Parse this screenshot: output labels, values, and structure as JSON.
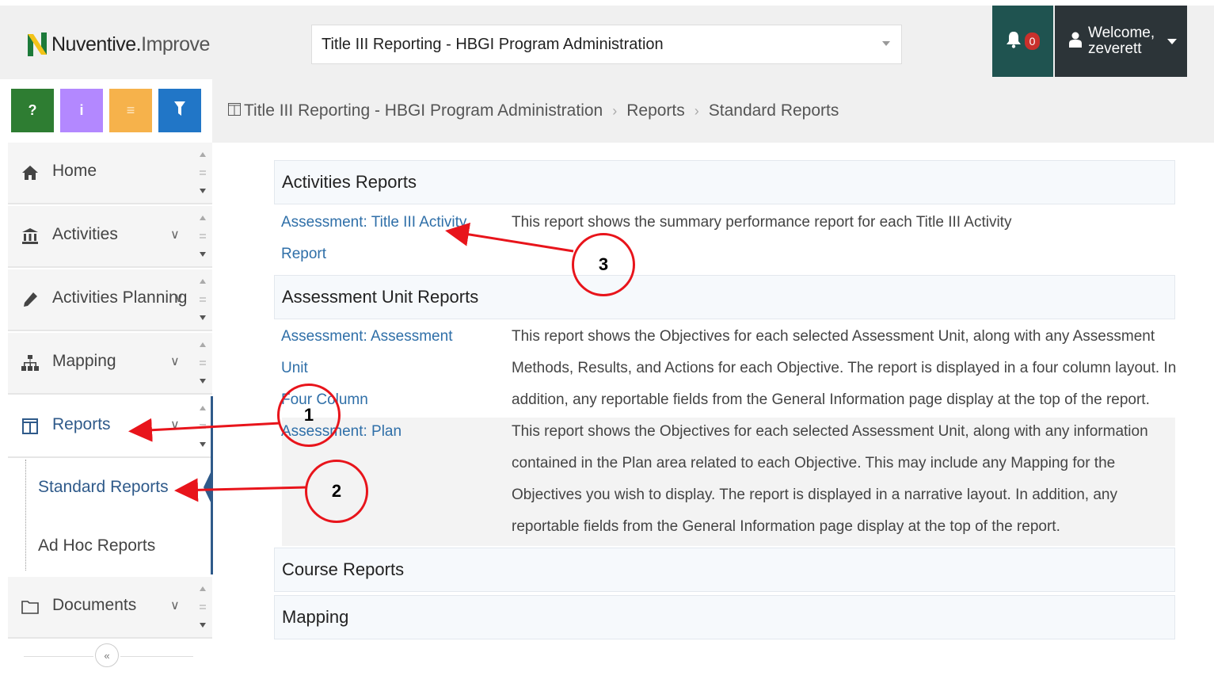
{
  "app": {
    "logo_brand": "Nuventive.",
    "logo_product": "Improve"
  },
  "header": {
    "program_selector_value": "Title III Reporting - HBGI Program Administration",
    "notification_count": "0",
    "welcome_line1": "Welcome,",
    "welcome_line2": "zeverett"
  },
  "tiles": [
    {
      "icon": "question-icon",
      "glyph": "?",
      "color": "#2e7d32"
    },
    {
      "icon": "info-icon",
      "glyph": "i",
      "color": "#b388ff"
    },
    {
      "icon": "list-icon",
      "glyph": "≡",
      "color": "#f6b24b"
    },
    {
      "icon": "filter-icon",
      "glyph": "▼",
      "color": "#2176c7"
    }
  ],
  "breadcrumb": {
    "item1": "Title III Reporting - HBGI Program Administration",
    "item2": "Reports",
    "item3": "Standard Reports"
  },
  "sidebar": {
    "items": [
      {
        "label": "Home",
        "icon": "home-icon"
      },
      {
        "label": "Activities",
        "icon": "bank-icon"
      },
      {
        "label": "Activities Planning",
        "icon": "pencil-icon"
      },
      {
        "label": "Mapping",
        "icon": "sitemap-icon"
      },
      {
        "label": "Reports",
        "icon": "columns-icon"
      },
      {
        "label": "Documents",
        "icon": "folder-icon"
      }
    ],
    "sub_items": [
      {
        "label": "Standard Reports"
      },
      {
        "label": "Ad Hoc Reports"
      }
    ],
    "collapse_glyph": "«"
  },
  "content": {
    "sections": [
      {
        "title": "Activities Reports"
      },
      {
        "title": "Assessment Unit Reports"
      },
      {
        "title": "Course Reports"
      },
      {
        "title": "Mapping"
      }
    ],
    "reports": [
      {
        "link_line1": "Assessment: Title III Activity",
        "link_line2": "Report",
        "desc": "This report shows the summary performance report for each Title III Activity"
      },
      {
        "link_line1": "Assessment: Assessment Unit",
        "link_line2": "Four Column",
        "desc": "This report shows the Objectives for each selected Assessment Unit, along with any Assessment Methods, Results, and Actions for each Objective. The report is displayed in a four column layout. In addition, any reportable fields from the General Information page display at the top of the report."
      },
      {
        "link_line1": "Assessment: Plan",
        "desc": "This report shows the Objectives for each selected Assessment Unit, along with any information contained in the Plan area related to each Objective. This may include any Mapping for the Objectives you wish to display. The report is displayed in a narrative layout. In addition, any reportable fields from the General Information page display at the top of the report."
      }
    ]
  },
  "callouts": {
    "c1": "1",
    "c2": "2",
    "c3": "3"
  },
  "colors": {
    "accent": "#2f5a8a",
    "link": "#2f6fa8",
    "notif_bg": "#1f5350",
    "welcome_bg": "#2c3438",
    "callout": "#e8141b"
  }
}
